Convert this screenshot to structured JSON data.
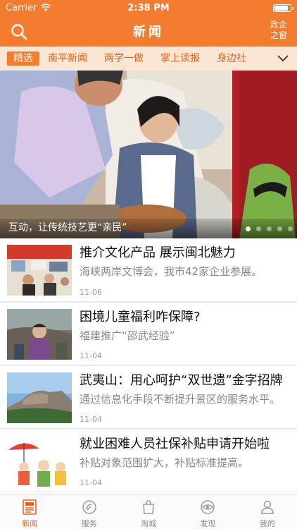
{
  "status_bar": {
    "carrier": "Carrier",
    "time": "2:38 PM"
  },
  "header": {
    "title": "新闻",
    "right_link": "政企之窗"
  },
  "tabs": [
    {
      "label": "精选",
      "active": true
    },
    {
      "label": "南平新闻"
    },
    {
      "label": "两学一做"
    },
    {
      "label": "掌上读报"
    },
    {
      "label": "身边社"
    }
  ],
  "hero": {
    "caption": "互动，让传统技艺更“亲民”",
    "dot_count": 5,
    "active_dot": 0
  },
  "news": [
    {
      "title": "推介文化产品 展示闽北魅力",
      "summary": "海峡两岸文博会，我市42家企业参展。",
      "date": "11-06"
    },
    {
      "title": "困境儿童福利咋保障?",
      "summary": "福建推广“邵武经验”",
      "date": "11-04"
    },
    {
      "title": "武夷山：用心呵护“双世遗”金字招牌",
      "summary": "通过信息化手段不断提升景区的服务水平。",
      "date": "11-04"
    },
    {
      "title": "就业困难人员社保补贴申请开始啦",
      "summary": "补贴对象范围扩大，补贴标准提高。",
      "date": "11-04"
    }
  ],
  "tabbar": [
    {
      "label": "新闻",
      "icon": "news-icon",
      "active": true
    },
    {
      "label": "服务",
      "icon": "service-icon"
    },
    {
      "label": "淘城",
      "icon": "shopping-bag-icon"
    },
    {
      "label": "发现",
      "icon": "discover-eye-icon"
    },
    {
      "label": "我的",
      "icon": "profile-icon"
    }
  ],
  "colors": {
    "brand": "#f47c30",
    "tab_strip": "#fbe6d4",
    "active_text": "#e8601c"
  }
}
